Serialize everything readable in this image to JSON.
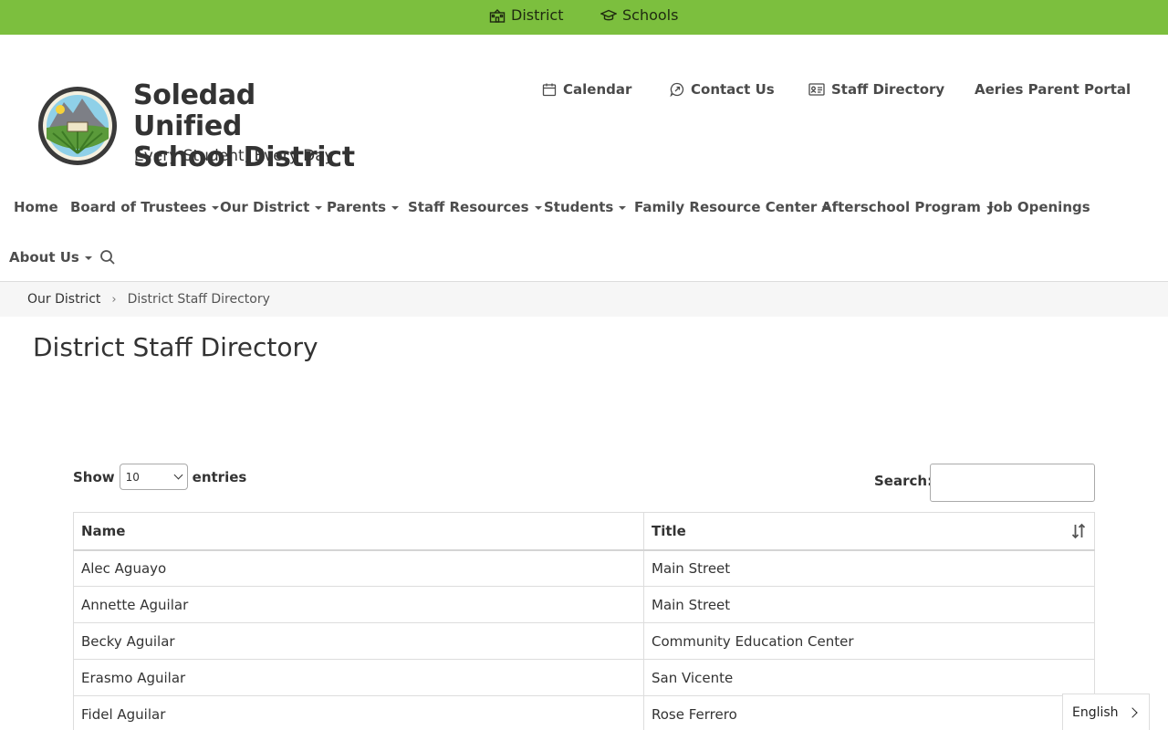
{
  "topbar": {
    "district_label": "District",
    "schools_label": "Schools"
  },
  "header": {
    "site_name_line1": "Soledad Unified",
    "site_name_line2": "School District",
    "tagline": "Every Student, Every Day"
  },
  "utility_nav": {
    "calendar": "Calendar",
    "contact": "Contact Us",
    "staff_directory": "Staff Directory",
    "parent_portal": "Aeries Parent Portal"
  },
  "main_nav": {
    "items": [
      {
        "label": "Home"
      },
      {
        "label": "Board of Trustees"
      },
      {
        "label": "Our District"
      },
      {
        "label": "Parents"
      },
      {
        "label": "Staff Resources"
      },
      {
        "label": "Students"
      },
      {
        "label": "Family Resource Center"
      },
      {
        "label": "Afterschool Program"
      },
      {
        "label": "Job Openings"
      },
      {
        "label": "About Us"
      }
    ]
  },
  "breadcrumb": {
    "parent": "Our District",
    "current": "District Staff Directory"
  },
  "page": {
    "title": "District Staff Directory"
  },
  "table_controls": {
    "show_label": "Show",
    "entries_value": "10",
    "entries_label": "entries",
    "search_label": "Search:",
    "search_value": ""
  },
  "table": {
    "headers": [
      "Name",
      "Title"
    ],
    "rows": [
      [
        "Alec Aguayo",
        "Main Street"
      ],
      [
        "Annette Aguilar",
        "Main Street"
      ],
      [
        "Becky Aguilar",
        "Community Education Center"
      ],
      [
        "Erasmo Aguilar",
        "San Vicente"
      ],
      [
        "Fidel Aguilar",
        "Rose Ferrero"
      ]
    ]
  },
  "language": {
    "current": "English"
  },
  "colors": {
    "topbar_green": "#7cbf3e",
    "text_dark": "#333333",
    "breadcrumb_bg": "#f6f6f6"
  },
  "icons": {
    "district": "school-building-icon",
    "schools": "graduation-cap-icon",
    "calendar": "calendar-icon",
    "contact": "chat-bubble-icon",
    "staff_directory": "id-card-icon",
    "search": "search-icon",
    "sort": "sort-icon"
  }
}
